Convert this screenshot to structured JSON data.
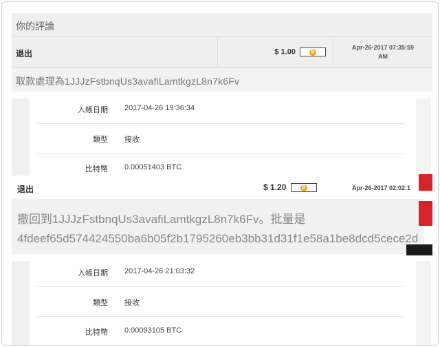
{
  "section1": {
    "title": "你的評論",
    "row": {
      "type_label": "退出",
      "amount": "$ 1.00",
      "datetime_line1": "Apr-26-2017 07:35:59",
      "datetime_line2": "AM"
    },
    "note": "取款處理為1JJJzFstbnqUs3avafiLamtkgzL8n7k6Fv",
    "details": [
      {
        "label": "入帳日期",
        "value": "2017-04-26 19:36:34"
      },
      {
        "label": "類型",
        "value": "接收"
      },
      {
        "label": "比特幣",
        "value": "0.00051403 BTC"
      }
    ]
  },
  "section2": {
    "row": {
      "type_label": "退出",
      "amount": "$ 1.20",
      "datetime": "Apr-26-2017 02:02:1"
    },
    "note_line1": "撤回到1JJJzFstbnqUs3avafiLamtkgzL8n7k6Fv。批量是",
    "note_line2": "4fdeef65d574424550ba6b05f2b1795260eb3bb31d31f1e58a1be8dcd5cece2d",
    "details": [
      {
        "label": "入帳日期",
        "value": "2017-04-26 21:03:32"
      },
      {
        "label": "類型",
        "value": "接收"
      },
      {
        "label": "比特幣",
        "value": "0.00093105 BTC"
      }
    ]
  },
  "icons": {
    "bitcoin": "bitcoin-icon"
  },
  "colors": {
    "bitcoin": "#f7a21b",
    "accent_red": "#d9232b"
  }
}
